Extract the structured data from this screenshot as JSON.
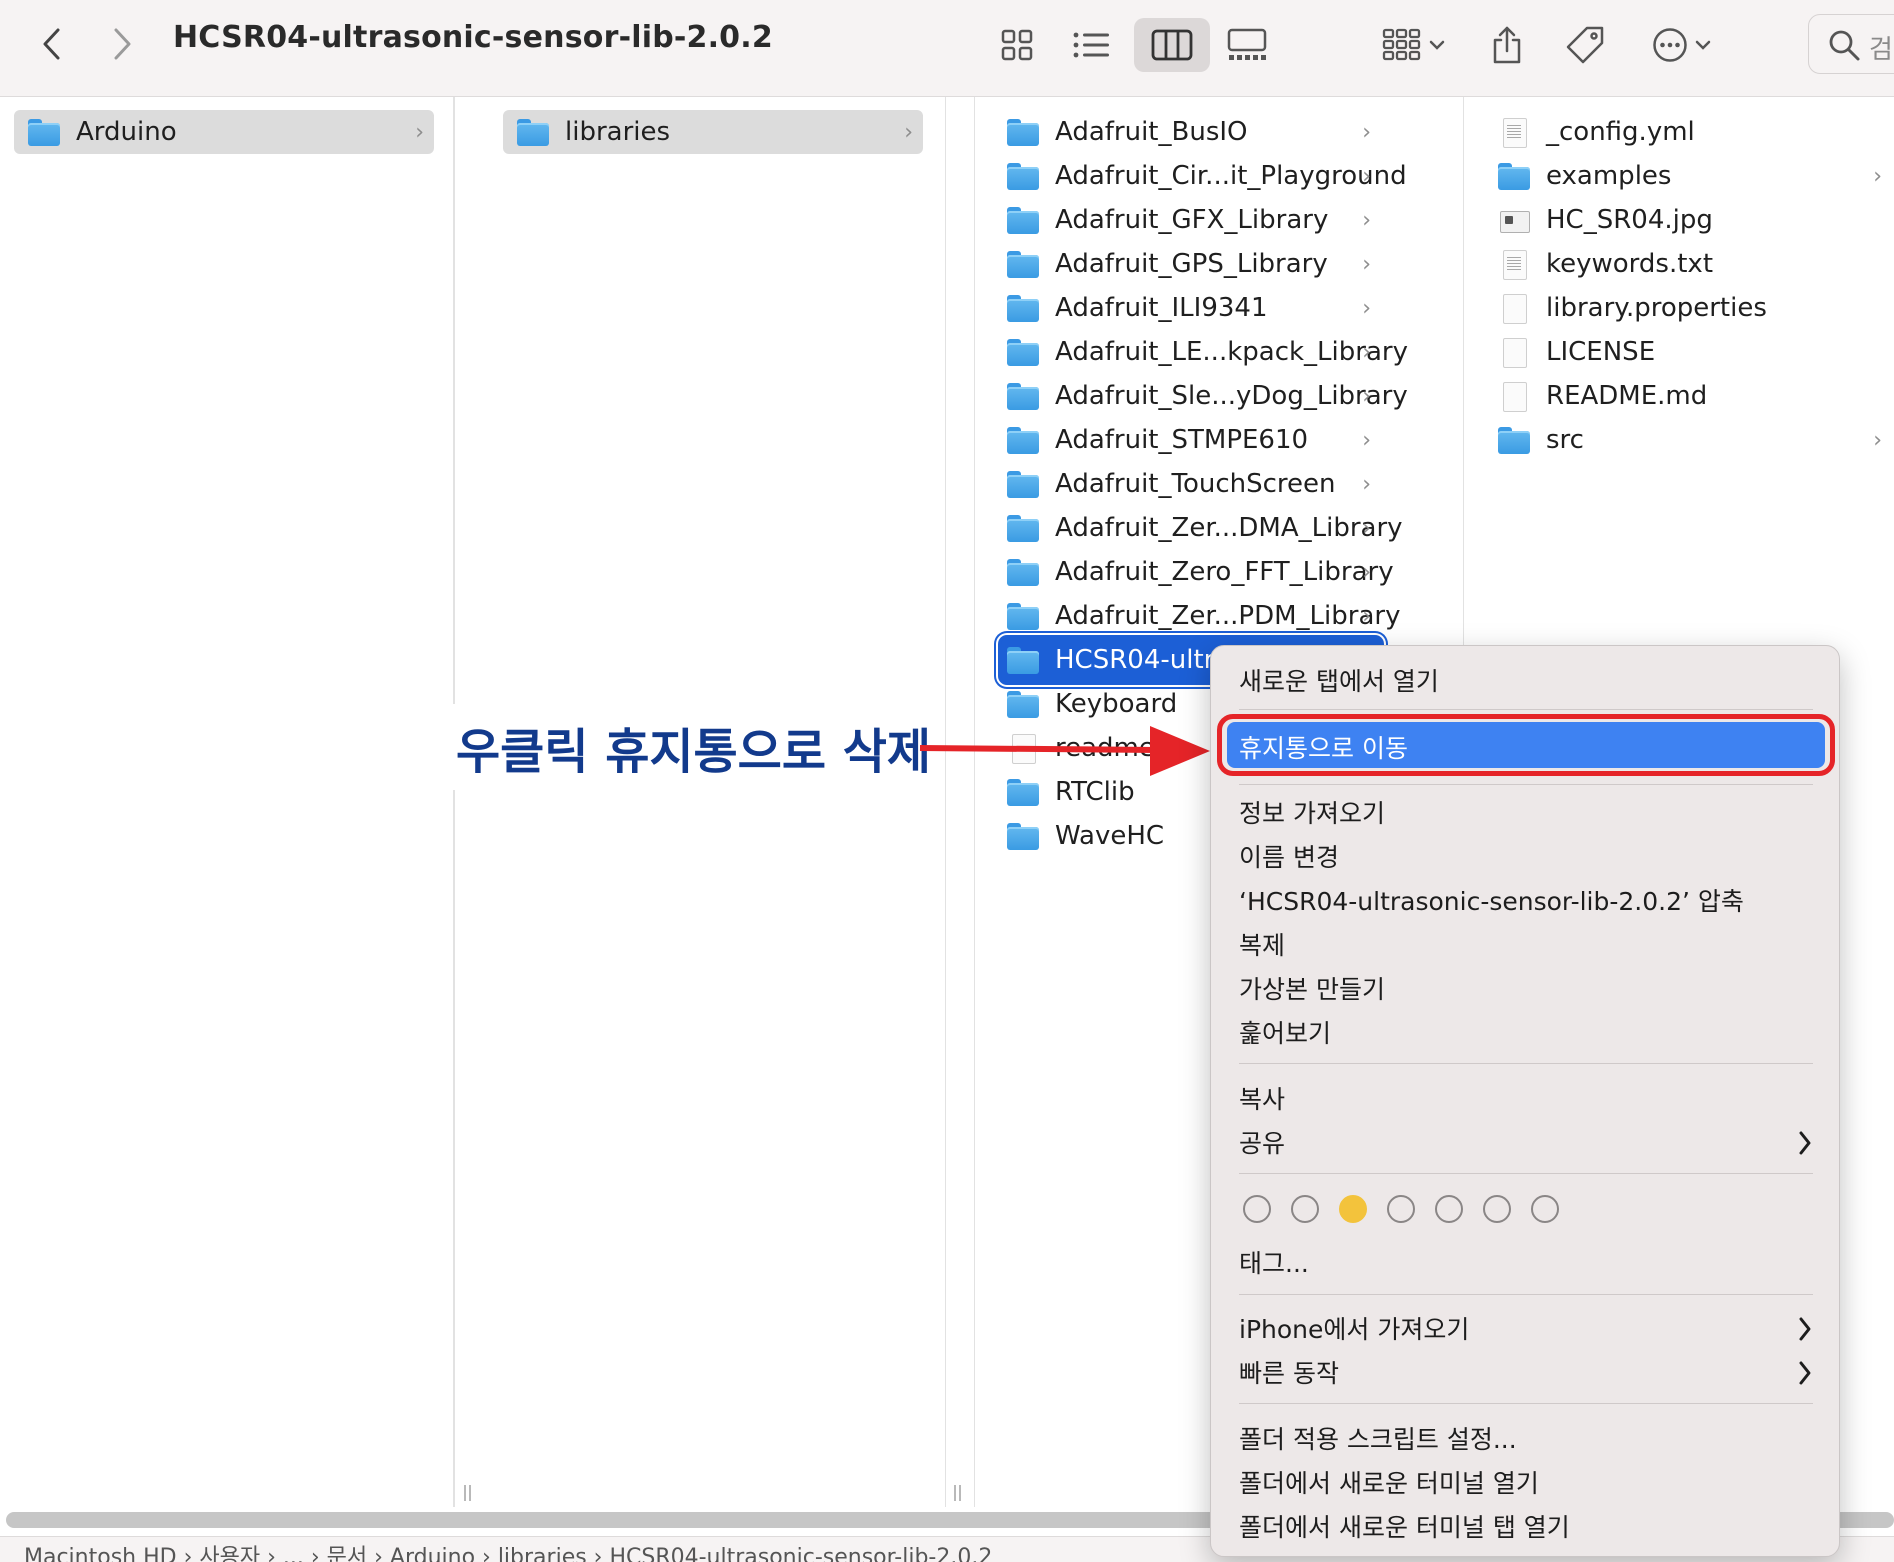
{
  "toolbar": {
    "title": "HCSR04-ultrasonic-sensor-lib-2.0.2",
    "back_icon": "chevron-left-icon",
    "forward_icon": "chevron-right-icon",
    "search_placeholder": "검"
  },
  "columns": {
    "col1": [
      {
        "name": "Arduino",
        "type": "folder",
        "selected": "grey",
        "has_children": true
      }
    ],
    "col2": [
      {
        "name": "libraries",
        "type": "folder",
        "selected": "grey",
        "has_children": true
      }
    ],
    "col3": [
      {
        "name": "Adafruit_BusIO",
        "type": "folder",
        "has_children": true
      },
      {
        "name": "Adafruit_Cir...it_Playground",
        "type": "folder",
        "has_children": true
      },
      {
        "name": "Adafruit_GFX_Library",
        "type": "folder",
        "has_children": true
      },
      {
        "name": "Adafruit_GPS_Library",
        "type": "folder",
        "has_children": true
      },
      {
        "name": "Adafruit_ILI9341",
        "type": "folder",
        "has_children": true
      },
      {
        "name": "Adafruit_LE...kpack_Library",
        "type": "folder",
        "has_children": true
      },
      {
        "name": "Adafruit_Sle...yDog_Library",
        "type": "folder",
        "has_children": true
      },
      {
        "name": "Adafruit_STMPE610",
        "type": "folder",
        "has_children": true
      },
      {
        "name": "Adafruit_TouchScreen",
        "type": "folder",
        "has_children": true
      },
      {
        "name": "Adafruit_Zer...DMA_Library",
        "type": "folder",
        "has_children": true
      },
      {
        "name": "Adafruit_Zero_FFT_Library",
        "type": "folder",
        "has_children": true
      },
      {
        "name": "Adafruit_Zer...PDM_Library",
        "type": "folder",
        "has_children": true
      },
      {
        "name": "HCSR04-ultr...",
        "type": "folder",
        "selected": "blue",
        "has_children": true
      },
      {
        "name": "Keyboard",
        "type": "folder",
        "has_children": true
      },
      {
        "name": "readme.tx",
        "type": "doc",
        "has_children": false
      },
      {
        "name": "RTClib",
        "type": "folder",
        "has_children": true
      },
      {
        "name": "WaveHC",
        "type": "folder",
        "has_children": true
      }
    ],
    "col4": [
      {
        "name": "_config.yml",
        "type": "doc-lines",
        "has_children": false
      },
      {
        "name": "examples",
        "type": "folder",
        "has_children": true
      },
      {
        "name": "HC_SR04.jpg",
        "type": "image",
        "has_children": false
      },
      {
        "name": "keywords.txt",
        "type": "doc-lines",
        "has_children": false
      },
      {
        "name": "library.properties",
        "type": "doc",
        "has_children": false
      },
      {
        "name": "LICENSE",
        "type": "doc",
        "has_children": false
      },
      {
        "name": "README.md",
        "type": "doc",
        "has_children": false
      },
      {
        "name": "src",
        "type": "folder",
        "has_children": true
      }
    ]
  },
  "annotation": {
    "text": "우클릭 휴지통으로 삭제",
    "color": "#123a8c",
    "arrow_color": "#e52428"
  },
  "menu": {
    "open_new_tab": "새로운 탭에서 열기",
    "move_to_trash": "휴지통으로 이동",
    "get_info": "정보 가져오기",
    "rename": "이름 변경",
    "compress": "‘HCSR04-ultrasonic-sensor-lib-2.0.2’ 압축",
    "duplicate": "복제",
    "make_alias": "가상본 만들기",
    "quick_look": "훑어보기",
    "copy": "복사",
    "share": "공유",
    "tag_colors": [
      "none",
      "none",
      "#f3c33c",
      "none",
      "none",
      "none",
      "none"
    ],
    "tags": "태그...",
    "import_iphone": "iPhone에서 가져오기",
    "quick_actions": "빠른 동작",
    "folder_actions": "폴더 적용 스크립트 설정...",
    "new_terminal": "폴더에서 새로운 터미널 열기",
    "new_terminal_tab": "폴더에서 새로운 터미널 탭 열기"
  },
  "pathbar": {
    "crumbs": "Macintosh HD  ›  사용자  ›  ...  ›  문서  ›  Arduino  ›  libraries  ›  HCSR04-ultrasonic-sensor-lib-2.0.2"
  },
  "colors": {
    "selection_blue": "#1c5fd6",
    "menu_highlight": "#3e82f2",
    "highlight_ring": "#e52428",
    "folder_blue": "#3a9be3"
  }
}
